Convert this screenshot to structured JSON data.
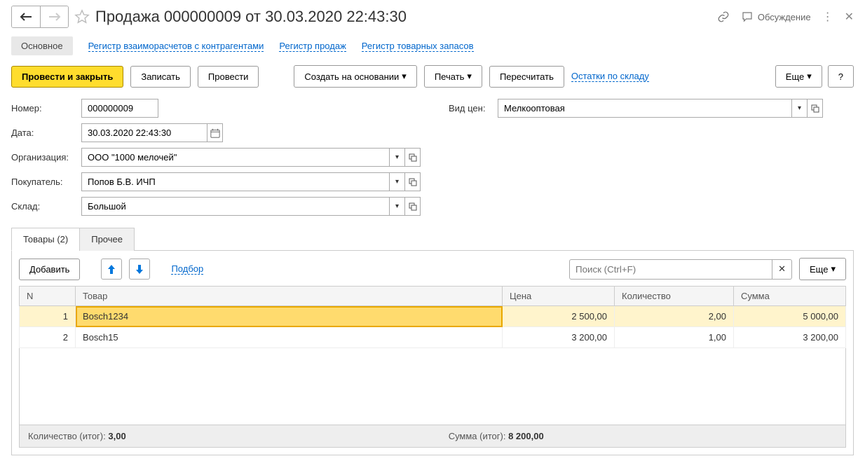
{
  "title": "Продажа 000000009 от 30.03.2020 22:43:30",
  "header_links": {
    "discuss": "Обсуждение"
  },
  "nav": {
    "main": "Основное",
    "reg1": "Регистр взаиморасчетов с контрагентами",
    "reg2": "Регистр продаж",
    "reg3": "Регистр товарных запасов"
  },
  "toolbar": {
    "post_close": "Провести и закрыть",
    "write": "Записать",
    "post": "Провести",
    "create_based": "Создать на основании",
    "print": "Печать",
    "recalc": "Пересчитать",
    "stock_link": "Остатки по складу",
    "more": "Еще",
    "help": "?"
  },
  "fields": {
    "number_label": "Номер:",
    "number_value": "000000009",
    "date_label": "Дата:",
    "date_value": "30.03.2020 22:43:30",
    "org_label": "Организация:",
    "org_value": "ООО \"1000 мелочей\"",
    "buyer_label": "Покупатель:",
    "buyer_value": "Попов Б.В. ИЧП",
    "warehouse_label": "Склад:",
    "warehouse_value": "Большой",
    "price_type_label": "Вид цен:",
    "price_type_value": "Мелкооптовая"
  },
  "tabs": {
    "goods": "Товары (2)",
    "other": "Прочее"
  },
  "tab_toolbar": {
    "add": "Добавить",
    "pick": "Подбор",
    "search_placeholder": "Поиск (Ctrl+F)",
    "more": "Еще"
  },
  "grid": {
    "headers": {
      "n": "N",
      "product": "Товар",
      "price": "Цена",
      "qty": "Количество",
      "sum": "Сумма"
    },
    "rows": [
      {
        "n": "1",
        "product": "Bosch1234",
        "price": "2 500,00",
        "qty": "2,00",
        "sum": "5 000,00"
      },
      {
        "n": "2",
        "product": "Bosch15",
        "price": "3 200,00",
        "qty": "1,00",
        "sum": "3 200,00"
      }
    ]
  },
  "totals": {
    "qty_label": "Количество (итог):",
    "qty_value": "3,00",
    "sum_label": "Сумма (итог):",
    "sum_value": "8 200,00"
  }
}
